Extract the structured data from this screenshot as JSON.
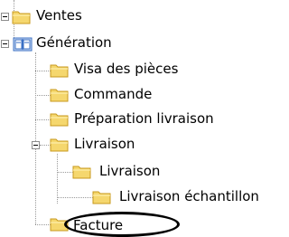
{
  "tree": {
    "items": [
      {
        "label": "Ventes",
        "icon": "folder-icon"
      },
      {
        "label": "Génération",
        "icon": "book-icon"
      },
      {
        "label": "Visa des pièces",
        "icon": "folder-icon"
      },
      {
        "label": "Commande",
        "icon": "folder-icon"
      },
      {
        "label": "Préparation livraison",
        "icon": "folder-icon"
      },
      {
        "label": "Livraison",
        "icon": "folder-icon"
      },
      {
        "label": "Livraison",
        "icon": "folder-icon"
      },
      {
        "label": "Livraison échantillon",
        "icon": "folder-icon"
      },
      {
        "label": "Facture",
        "icon": "folder-icon"
      }
    ]
  },
  "colors": {
    "folder_fill": "#f5d76e",
    "folder_dark": "#c89a1e",
    "book_blue": "#3a6fc4",
    "annotation": "#000000"
  }
}
